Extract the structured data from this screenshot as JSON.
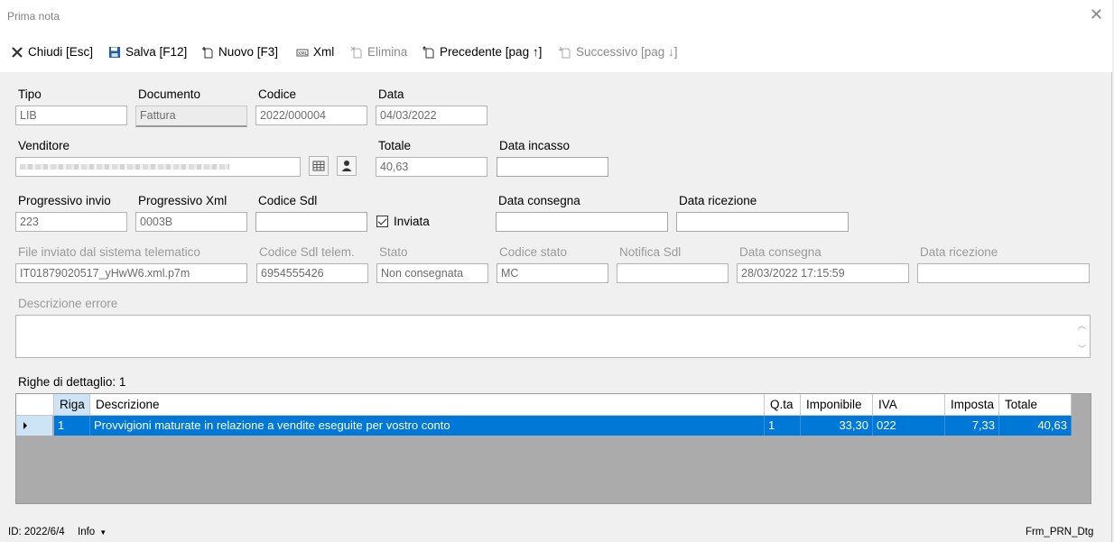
{
  "window": {
    "title": "Prima nota"
  },
  "toolbar": {
    "close_label": "Chiudi [Esc]",
    "save_label": "Salva [F12]",
    "new_label": "Nuovo [F3]",
    "xml_label": "Xml",
    "delete_label": "Elimina",
    "prev_label": "Precedente [pag ↑]",
    "next_label": "Successivo [pag ↓]"
  },
  "form": {
    "tipo": {
      "label": "Tipo",
      "value": "LIB"
    },
    "documento": {
      "label": "Documento",
      "value": "Fattura"
    },
    "codice": {
      "label": "Codice",
      "value": "2022/000004"
    },
    "data": {
      "label": "Data",
      "value": "04/03/2022"
    },
    "venditore": {
      "label": "Venditore",
      "value": ""
    },
    "totale": {
      "label": "Totale",
      "value": "40,63"
    },
    "data_incasso": {
      "label": "Data incasso",
      "value": ""
    },
    "progressivo_invio": {
      "label": "Progressivo invio",
      "value": "223"
    },
    "progressivo_xml": {
      "label": "Progressivo Xml",
      "value": "0003B"
    },
    "codice_sdl": {
      "label": "Codice Sdl",
      "value": ""
    },
    "inviata": {
      "label": "Inviata",
      "checked": true
    },
    "data_consegna": {
      "label": "Data consegna",
      "value": ""
    },
    "data_ricezione": {
      "label": "Data ricezione",
      "value": ""
    },
    "file_inviato": {
      "label": "File inviato dal sistema telematico",
      "value": "IT01879020517_yHwW6.xml.p7m"
    },
    "codice_sdl_telem": {
      "label": "Codice Sdl telem.",
      "value": "6954555426"
    },
    "stato": {
      "label": "Stato",
      "value": "Non consegnata"
    },
    "codice_stato": {
      "label": "Codice stato",
      "value": "MC"
    },
    "notifica_sdl": {
      "label": "Notifica Sdl",
      "value": ""
    },
    "data_consegna_telem": {
      "label": "Data consegna",
      "value": "28/03/2022 17:15:59"
    },
    "data_ricezione_telem": {
      "label": "Data ricezione",
      "value": ""
    },
    "descrizione_errore": {
      "label": "Descrizione errore",
      "value": ""
    }
  },
  "detail": {
    "title": "Righe di dettaglio: 1",
    "columns": [
      "Riga",
      "Descrizione",
      "Q.ta",
      "Imponibile",
      "IVA",
      "Imposta",
      "Totale"
    ],
    "rows": [
      {
        "riga": "1",
        "descrizione": "Provvigioni maturate in relazione a vendite eseguite per vostro conto",
        "qta": "1",
        "imponibile": "33,30",
        "iva": "022",
        "imposta": "7,33",
        "totale": "40,63"
      }
    ]
  },
  "status": {
    "id": "ID: 2022/6/4",
    "info_label": "Info",
    "form_name": "Frm_PRN_Dtg"
  },
  "colors": {
    "selection": "#0078d7",
    "grid_bg": "#ababab",
    "header_sel": "#cde4f7"
  }
}
